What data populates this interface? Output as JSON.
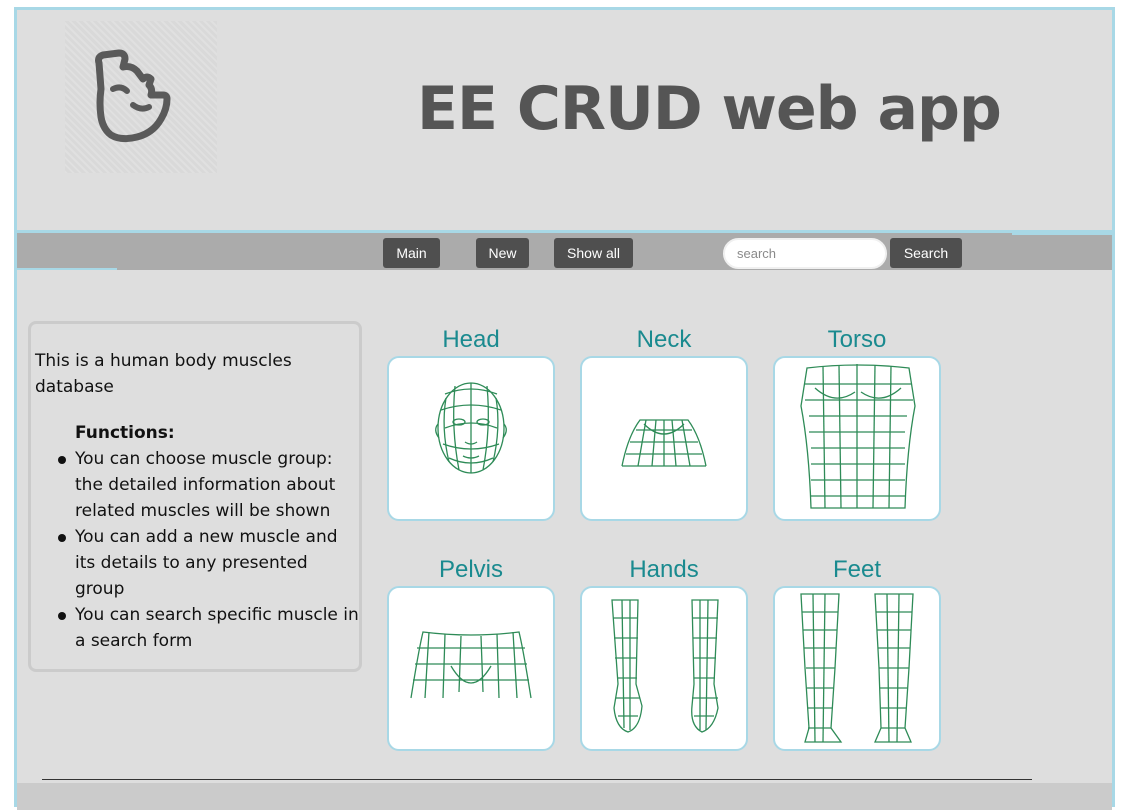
{
  "header": {
    "title": "EE CRUD web app",
    "logo_icon": "flexed-arm-icon"
  },
  "nav": {
    "main_label": "Main",
    "new_label": "New",
    "show_all_label": "Show all",
    "search_placeholder": "search",
    "search_button_label": "Search"
  },
  "info": {
    "intro": "This is a human body muscles database",
    "functions_heading": "Functions:",
    "functions": [
      "You can choose muscle group: the detailed information about related muscles will be shown",
      "You can add a new muscle and its details to any presented group",
      "You can search specific muscle in a search form"
    ]
  },
  "body_parts": [
    {
      "label": "Head",
      "image": "head-wireframe"
    },
    {
      "label": "Neck",
      "image": "neck-wireframe"
    },
    {
      "label": "Torso",
      "image": "torso-wireframe"
    },
    {
      "label": "Pelvis",
      "image": "pelvis-wireframe"
    },
    {
      "label": "Hands",
      "image": "hands-wireframe"
    },
    {
      "label": "Feet",
      "image": "feet-wireframe"
    }
  ],
  "colors": {
    "accent_border": "#a8d8e6",
    "part_title": "#1a8a8f",
    "wireframe": "#2e8b57",
    "button_bg": "#4f4f4f"
  }
}
